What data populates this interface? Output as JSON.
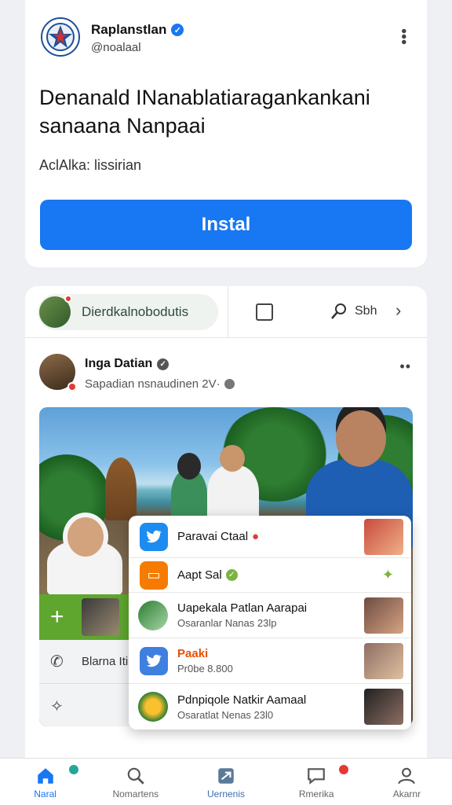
{
  "install_card": {
    "app_name": "Raplanstlan",
    "handle": "@noalaal",
    "headline": "Denanald INanablatiaragankankani sanaana Nanpaai",
    "subline": "AclAlka: lissirian",
    "install_label": "Instal"
  },
  "quickbar": {
    "pill_label": "Dierdkalnobodutis",
    "search_label": "Sbh"
  },
  "post": {
    "author": "Inga Datian",
    "meta": "Sapadian nsnaudinen 2V·"
  },
  "side_actions": {
    "row1_label": "Blarna Iti"
  },
  "overlay_list": [
    {
      "title": "Paravai Ctaal",
      "subtitle": ""
    },
    {
      "title": "Aapt Sal",
      "subtitle": ""
    },
    {
      "title": "Uapekala Patlan Aarapai",
      "subtitle": "Osaranlar Nanas 23lp"
    },
    {
      "title": "Paaki",
      "subtitle": "Pr0be 8.800"
    },
    {
      "title": "Pdnpiqole Natkir Aamaal",
      "subtitle": "Osaratlat Nenas 23l0"
    }
  ],
  "bottom_nav": [
    {
      "label": "Naral",
      "icon": "home-icon"
    },
    {
      "label": "Nomartens",
      "icon": "search-icon"
    },
    {
      "label": "Uernenis",
      "icon": "send-icon"
    },
    {
      "label": "Rmerika",
      "icon": "chat-icon"
    },
    {
      "label": "Akarnr",
      "icon": "person-icon"
    }
  ],
  "colors": {
    "accent": "#1877f2",
    "green": "#5fa62f",
    "badge_red": "#e53935",
    "badge_teal": "#26a69a"
  }
}
